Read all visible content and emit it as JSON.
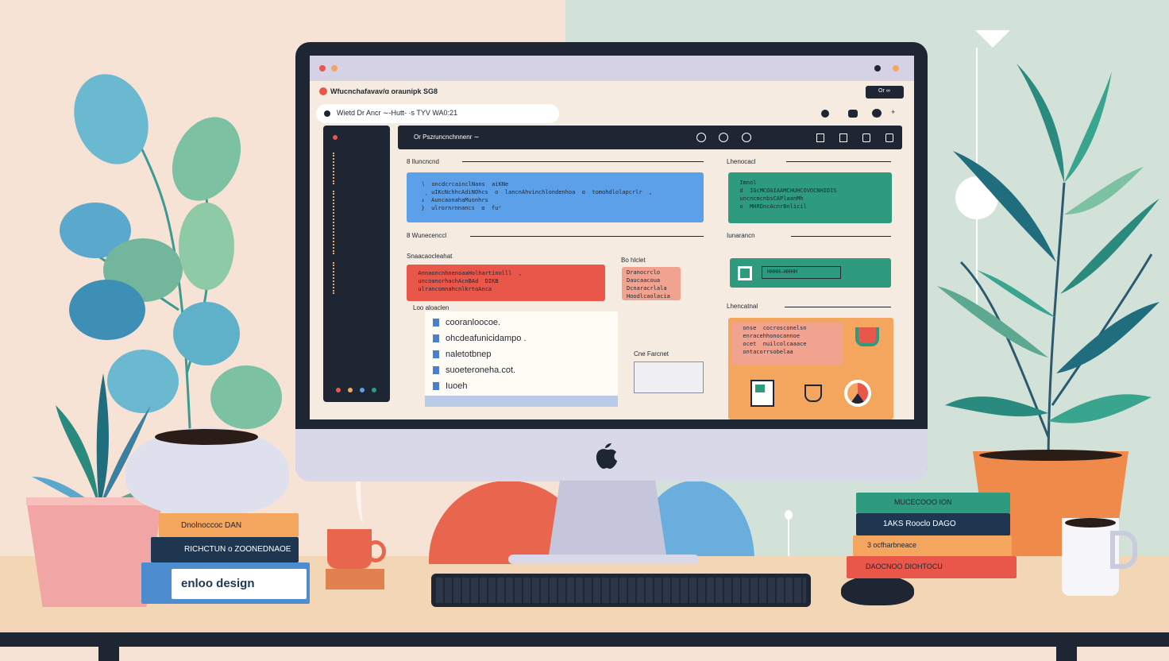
{
  "app": {
    "window_title": "Wfucnchafavav/ɑ oraunipk  SG8",
    "url_bar": "Wietd  Dr  Ancr ∼-Hutt-  ·s TYV  WA0:21",
    "header_button": "Or  ∞"
  },
  "toolbar": {
    "path_label": "Or  Pszruncnchnnenr  ∼"
  },
  "sections": {
    "top_left_title": "8 Iluncncnd",
    "top_left_code": [
      "  ∖  oncdcrcainclNans  aiKNe",
      "   ¸ uIKcNchhcAdiNOhcs  o  lancnAhvinchlondenhoa  ɑ  tomohdlolapcrlr  ,",
      "  ↓  AuncaonahaMuonhrs",
      "  }  ulrornrnnancs  ɑ  fuˣ"
    ],
    "mid_left_title": "8  Wunecenccl",
    "mid_left_subtitle": "Snaacaocleahat",
    "red_card_code": [
      "  AnnaoncnhnenoaaHolhartinolll  ,",
      "  uncoanorhachAcnBAd  DIKB",
      "  ulrancomnahcnlkrtoAnca"
    ],
    "side_note_title": "Bo  hlclet",
    "side_note_lines": [
      "Dranocrclo",
      "Daucaacoua",
      "Dcnaracrlala",
      "Hoodlcaolacia"
    ],
    "file_list_title": "Loo  aloaclen",
    "files": [
      "cooranloocoe.",
      "ohcdeafunicidampo .",
      "naletotbnep",
      "suoeteroneha.cot.",
      "Iuoeh"
    ],
    "form_title": "Cne  Farcnet",
    "top_right_title": "Lhenocacl",
    "top_right_code": [
      "  Imnol",
      "  d  IGcMCOAIAAMCHUHCOVOCNHIDIS",
      "  uncncmcnbsCAPlaanMh",
      "  o  MHRDncAcnrBnlicil"
    ],
    "mid_right_title": "Iunarancn",
    "mid_right_field": "HHHH–HHHH",
    "bottom_right_title": "Lhencatnal",
    "orange_card_code": [
      "  onse  cocrosconelsn",
      "  enracehhonocannoe",
      "  ocet  nuilcolcaaace",
      "  ontacorrsobelaa"
    ]
  },
  "books_left": [
    "Dnolnoccoc  DAN",
    "RICHCTUN  o  ZOONEDNAOE",
    "enloo  design"
  ],
  "books_right": [
    "MUCECOOO  ION",
    "1AKS  Rooclo  DAGO",
    "3  ocfharbneace",
    "DAOCNOO  DIOHTOCU"
  ],
  "colors": {
    "accent_blue": "#5ba0e8",
    "accent_green": "#2e9a7e",
    "accent_red": "#e8574a",
    "accent_orange": "#f4a55e",
    "dark": "#1f2633"
  },
  "icons": [
    "apple-logo-icon",
    "plant-icon",
    "mug-icon",
    "keyboard-icon",
    "mouse-icon"
  ]
}
